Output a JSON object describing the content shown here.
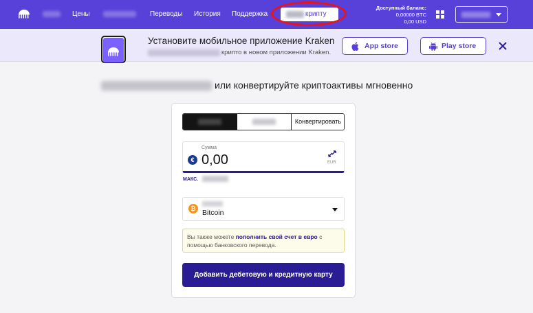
{
  "nav": {
    "links": [
      "Цены",
      "Переводы",
      "История",
      "Поддержка"
    ],
    "active_tab_suffix": "крипту",
    "balance_title": "Доступный баланс:",
    "balance_btc": "0,00000 BTC",
    "balance_usd": "0,00 USD",
    "icons": {
      "logo": "kraken-logo",
      "grid": "apps-grid-icon",
      "caret": "chevron-down-icon"
    }
  },
  "banner": {
    "title": "Установите мобильное приложение Kraken",
    "subtitle_visible": "крипто в новом приложении Kraken.",
    "app_store_label": "App store",
    "play_store_label": "Play store"
  },
  "main": {
    "heading_visible": "или конвертируйте криптоактивы мгновенно"
  },
  "trade": {
    "tab_convert": "Конвертировать",
    "amount_label": "Сумма",
    "amount_value": "0,00",
    "currency": "EUR",
    "max_label": "МАКС.",
    "asset_value": "Bitcoin",
    "notice_prefix": "Вы также можете ",
    "notice_link": "пополнить свой счет в евро",
    "notice_suffix": " с помощью банковского перевода.",
    "cta_label": "Добавить дебетовую и кредитную карту"
  },
  "colors": {
    "nav_bg": "#5741d9",
    "primary_dark": "#2a1c94",
    "highlight_ellipse": "#e8141b",
    "banner_bg": "#ece8fb",
    "bitcoin": "#f7931a",
    "euro": "#1c3b8f"
  }
}
